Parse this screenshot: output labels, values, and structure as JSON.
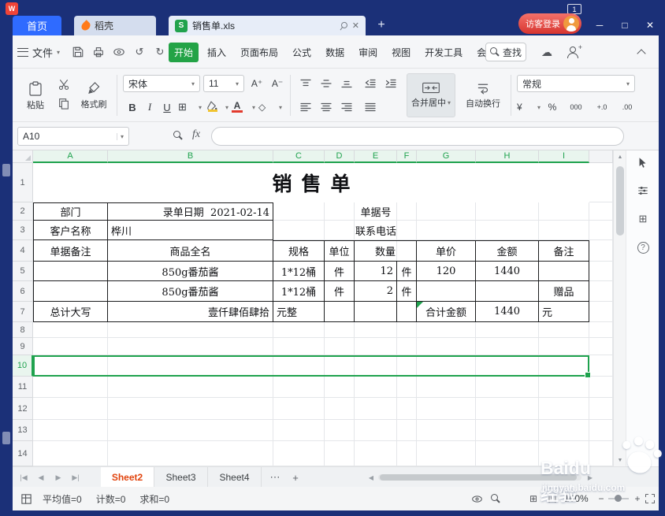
{
  "titlebar": {
    "home_tab": "首页",
    "docer_tab": "稻壳",
    "doc_tab": "销售单.xls",
    "login": "访客登录",
    "window_mode": "1"
  },
  "menubar": {
    "file": "文件",
    "tabs": [
      "开始",
      "插入",
      "页面布局",
      "公式",
      "数据",
      "审阅",
      "视图",
      "开发工具",
      "会员专享"
    ],
    "find": "查找"
  },
  "toolbar": {
    "paste": "粘贴",
    "format_painter": "格式刷",
    "font_name": "宋体",
    "font_size": "11",
    "bold": "B",
    "italic": "I",
    "underline": "U",
    "grow_font": "A⁺",
    "shrink_font": "A⁻",
    "merge_center": "合并居中",
    "wrap_text": "自动换行",
    "number_format": "常规",
    "currency": "¥",
    "percent": "%",
    "thousands": "000",
    "inc_decimal": "+.0",
    "dec_decimal": ".00"
  },
  "formula_bar": {
    "name_box": "A10",
    "fx": "fx",
    "input": ""
  },
  "grid": {
    "columns": [
      "A",
      "B",
      "C",
      "D",
      "E",
      "F",
      "G",
      "H",
      "I"
    ],
    "rows": [
      1,
      2,
      3,
      4,
      5,
      6,
      7,
      8,
      9,
      10,
      11,
      12,
      13,
      14
    ],
    "selection": {
      "row": 10,
      "col_start": "A",
      "col_end": "I",
      "ref": "A10"
    },
    "cells": [
      {
        "r": 1,
        "c": "A",
        "span": 9,
        "t": "销售单",
        "style": "title"
      },
      {
        "r": 2,
        "c": "A",
        "t": "部门",
        "b": "ltrb"
      },
      {
        "r": 2,
        "c": "B",
        "t": "录单日期  2021-02-14",
        "b": "trb",
        "al": "r"
      },
      {
        "r": 2,
        "c": "E",
        "t": "单据号"
      },
      {
        "r": 3,
        "c": "A",
        "t": "客户名称",
        "b": "lrb"
      },
      {
        "r": 3,
        "c": "B",
        "t": "桦川",
        "b": "rb",
        "al": "l"
      },
      {
        "r": 3,
        "c": "E",
        "t": "联系电话"
      },
      {
        "r": 4,
        "c": "A",
        "t": "单据备注",
        "b": "lrb"
      },
      {
        "r": 4,
        "c": "B",
        "t": "商品全名",
        "b": "rb"
      },
      {
        "r": 4,
        "c": "C",
        "t": "规格",
        "b": "trb"
      },
      {
        "r": 4,
        "c": "D",
        "t": "单位",
        "b": "trb"
      },
      {
        "r": 4,
        "c": "E",
        "span": 2,
        "t": "数量",
        "b": "trb"
      },
      {
        "r": 4,
        "c": "G",
        "t": "单价",
        "b": "trb"
      },
      {
        "r": 4,
        "c": "H",
        "t": "金额",
        "b": "trb"
      },
      {
        "r": 4,
        "c": "I",
        "t": "备注",
        "b": "trb"
      },
      {
        "r": 5,
        "c": "A",
        "t": "",
        "b": "lrb"
      },
      {
        "r": 5,
        "c": "B",
        "t": "850g番茄酱",
        "b": "rb"
      },
      {
        "r": 5,
        "c": "C",
        "t": "1*12桶",
        "b": "rb"
      },
      {
        "r": 5,
        "c": "D",
        "t": "件",
        "b": "rb"
      },
      {
        "r": 5,
        "c": "E",
        "t": "12",
        "b": "rb",
        "al": "r"
      },
      {
        "r": 5,
        "c": "F",
        "t": "件",
        "b": "rb"
      },
      {
        "r": 5,
        "c": "G",
        "t": "120",
        "b": "rb"
      },
      {
        "r": 5,
        "c": "H",
        "t": "1440",
        "b": "rb"
      },
      {
        "r": 5,
        "c": "I",
        "t": "",
        "b": "rb"
      },
      {
        "r": 6,
        "c": "A",
        "t": "",
        "b": "lrb"
      },
      {
        "r": 6,
        "c": "B",
        "t": "850g番茄酱",
        "b": "rb"
      },
      {
        "r": 6,
        "c": "C",
        "t": "1*12桶",
        "b": "rb"
      },
      {
        "r": 6,
        "c": "D",
        "t": "件",
        "b": "rb"
      },
      {
        "r": 6,
        "c": "E",
        "t": "2",
        "b": "rb",
        "al": "r"
      },
      {
        "r": 6,
        "c": "F",
        "t": "件",
        "b": "rb"
      },
      {
        "r": 6,
        "c": "G",
        "t": "",
        "b": "rb"
      },
      {
        "r": 6,
        "c": "H",
        "t": "",
        "b": "rb"
      },
      {
        "r": 6,
        "c": "I",
        "t": "赠品",
        "b": "rb"
      },
      {
        "r": 7,
        "c": "A",
        "t": "总计大写",
        "b": "lrb"
      },
      {
        "r": 7,
        "c": "B",
        "t": "壹仟肆佰肆拾",
        "b": "rb",
        "al": "r"
      },
      {
        "r": 7,
        "c": "C",
        "t": "元整",
        "b": "rb",
        "al": "l"
      },
      {
        "r": 7,
        "c": "D",
        "t": "",
        "b": "rb"
      },
      {
        "r": 7,
        "c": "E",
        "t": "",
        "b": "rb"
      },
      {
        "r": 7,
        "c": "F",
        "t": "",
        "b": "rb"
      },
      {
        "r": 7,
        "c": "G",
        "t": "合计金额",
        "b": "rb",
        "flag": true
      },
      {
        "r": 7,
        "c": "H",
        "t": "1440",
        "b": "rb"
      },
      {
        "r": 7,
        "c": "I",
        "t": "元",
        "b": "rb",
        "al": "l"
      }
    ]
  },
  "sheetbar": {
    "tabs": [
      "Sheet2",
      "Sheet3",
      "Sheet4"
    ],
    "active": "Sheet2"
  },
  "statusbar": {
    "average": "平均值=0",
    "count": "计数=0",
    "sum": "求和=0",
    "zoom": "100%"
  },
  "watermark": {
    "brand": "Baidu经验",
    "url": "jingyan.baidu.com"
  },
  "icons": {
    "plus": "+",
    "min": "─",
    "max": "□",
    "close": "✕",
    "tab_close": "✕",
    "cloud": "☁",
    "undo": "↺",
    "redo": "↻",
    "more_quick": "»",
    "caret": "▾",
    "borders": "⊞",
    "clear": "◇",
    "first_sheet": "|◀",
    "prev_sheet": "◀",
    "next_sheet": "▶",
    "last_sheet": "▶|",
    "more_sheets": "⋯",
    "add_sheet": "+",
    "scroll_up": "▲",
    "scroll_down": "▼",
    "scroll_left": "◀",
    "scroll_right": "▶",
    "normal_view": "⊞",
    "page_view": "凹",
    "zoom_in": "+",
    "zoom_out": "−",
    "help": "?",
    "layout_icon": "⊞"
  },
  "colors": {
    "accent_green": "#23a346",
    "selection_green": "#1fa24e",
    "home_blue": "#2f6bff",
    "frame_navy": "#1b3078",
    "active_sheet_text": "#e1440e"
  }
}
